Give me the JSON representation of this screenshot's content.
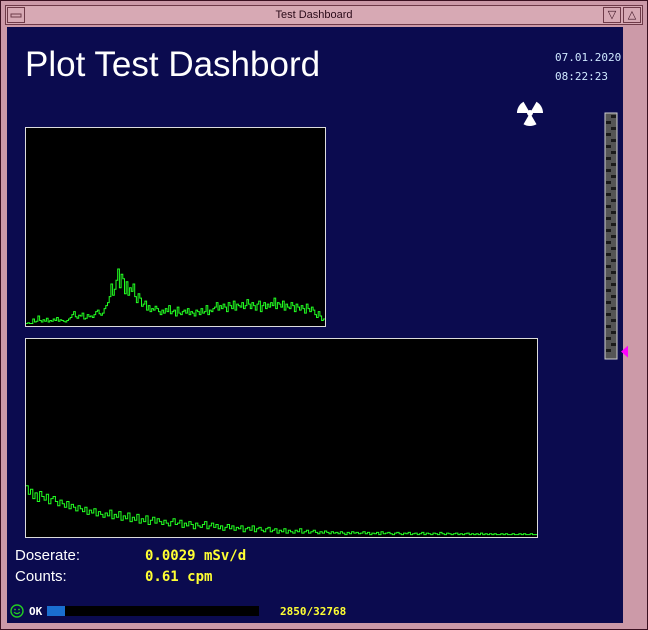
{
  "window": {
    "title": "Test Dashboard",
    "minimize_glyph": "▽",
    "maximize_glyph": "△",
    "menu_icon": "window-menu-icon"
  },
  "dashboard": {
    "title": "Plot Test Dashbord",
    "date": "07.01.2020",
    "time": "08:22:23",
    "warning_icon": "radiation-icon"
  },
  "readings": {
    "doserate": {
      "label": "Doserate:",
      "value": "0.0029 mSv/d"
    },
    "counts": {
      "label": "Counts:",
      "value": "0.61 cpm"
    }
  },
  "status": {
    "face_icon": "smiley-icon",
    "text": "OK",
    "progress_text": "2850/32768",
    "progress_value": 2850,
    "progress_max": 32768
  },
  "gauge": {
    "level_fraction": 0.03
  },
  "colors": {
    "trace": "#22ff22",
    "background": "#0b0b4f",
    "value_text": "#ffff33",
    "marker": "#ff00ff"
  },
  "chart_data": [
    {
      "type": "line",
      "title": "",
      "trace": "spectrum",
      "y": [
        2,
        3,
        2,
        2,
        8,
        4,
        5,
        12,
        6,
        4,
        7,
        5,
        9,
        4,
        6,
        5,
        8,
        6,
        10,
        5,
        7,
        6,
        5,
        4,
        6,
        8,
        10,
        14,
        18,
        11,
        9,
        13,
        12,
        16,
        8,
        9,
        14,
        11,
        12,
        10,
        14,
        18,
        20,
        15,
        13,
        16,
        22,
        26,
        30,
        38,
        55,
        40,
        48,
        60,
        75,
        50,
        68,
        62,
        42,
        58,
        40,
        50,
        45,
        55,
        38,
        30,
        42,
        36,
        25,
        28,
        32,
        20,
        26,
        18,
        22,
        20,
        25,
        22,
        18,
        14,
        20,
        16,
        22,
        18,
        26,
        15,
        18,
        20,
        12,
        24,
        16,
        14,
        18,
        20,
        16,
        22,
        14,
        18,
        16,
        12,
        20,
        18,
        14,
        22,
        16,
        18,
        26,
        14,
        20,
        18,
        22,
        24,
        30,
        20,
        26,
        22,
        28,
        24,
        18,
        30,
        26,
        22,
        32,
        20,
        28,
        26,
        24,
        30,
        22,
        26,
        34,
        28,
        22,
        30,
        26,
        20,
        28,
        32,
        18,
        26,
        30,
        22,
        28,
        24,
        30,
        26,
        36,
        22,
        30,
        28,
        24,
        32,
        20,
        28,
        24,
        22,
        30,
        26,
        18,
        28,
        24,
        20,
        26,
        22,
        16,
        28,
        22,
        18,
        24,
        20,
        14,
        10,
        18,
        12,
        6,
        8
      ]
    },
    {
      "type": "line",
      "title": "",
      "trace": "decay",
      "y": [
        70,
        58,
        65,
        52,
        60,
        48,
        62,
        55,
        50,
        58,
        45,
        52,
        55,
        48,
        42,
        50,
        45,
        40,
        48,
        38,
        44,
        40,
        35,
        42,
        38,
        34,
        40,
        30,
        36,
        32,
        38,
        28,
        34,
        30,
        26,
        32,
        28,
        36,
        24,
        30,
        26,
        34,
        22,
        28,
        24,
        32,
        20,
        26,
        22,
        30,
        18,
        24,
        20,
        28,
        16,
        22,
        26,
        18,
        24,
        20,
        16,
        22,
        18,
        14,
        20,
        24,
        16,
        18,
        22,
        12,
        18,
        14,
        20,
        16,
        10,
        18,
        14,
        12,
        16,
        20,
        10,
        14,
        18,
        12,
        16,
        10,
        14,
        8,
        12,
        16,
        10,
        14,
        8,
        12,
        10,
        14,
        6,
        10,
        12,
        8,
        14,
        6,
        10,
        12,
        8,
        6,
        10,
        12,
        6,
        8,
        10,
        4,
        8,
        6,
        10,
        4,
        8,
        6,
        4,
        8,
        6,
        10,
        4,
        6,
        8,
        4,
        6,
        8,
        5,
        3,
        6,
        4,
        7,
        5,
        3,
        6,
        4,
        5,
        3,
        6,
        4,
        2,
        5,
        3,
        6,
        4,
        5,
        3,
        4,
        6,
        3,
        5,
        2,
        4,
        3,
        5,
        2,
        6,
        3,
        4,
        5,
        3,
        2,
        4,
        5,
        3,
        2,
        4,
        3,
        5,
        2,
        3,
        4,
        2,
        3,
        5,
        2,
        4,
        3,
        2,
        4,
        3,
        2,
        5,
        3,
        2,
        4,
        3,
        2,
        3,
        4,
        2,
        3,
        2,
        3,
        4,
        2,
        3,
        2,
        3,
        2,
        4,
        2,
        3,
        2,
        3,
        2,
        3,
        2,
        2,
        3,
        2,
        3,
        2,
        2,
        3,
        2,
        2,
        3,
        2,
        3,
        2,
        2,
        3,
        2,
        2
      ]
    }
  ]
}
